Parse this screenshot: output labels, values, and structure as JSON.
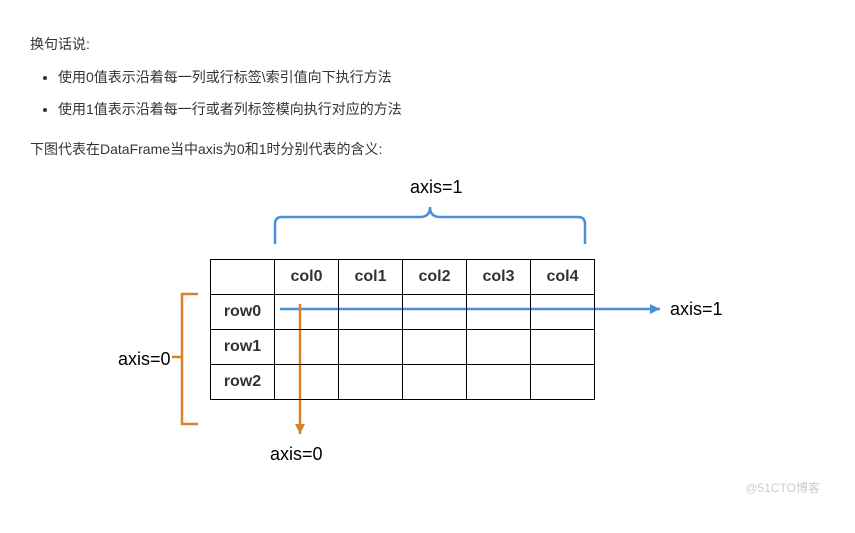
{
  "intro": "换句话说:",
  "bullets": [
    "使用0值表示沿着每一列或行标签\\索引值向下执行方法",
    "使用1值表示沿着每一行或者列标签模向执行对应的方法"
  ],
  "caption": "下图代表在DataFrame当中axis为0和1时分别代表的含义:",
  "diagram": {
    "axis1_top": "axis=1",
    "axis1_right": "axis=1",
    "axis0_left": "axis=0",
    "axis0_bottom": "axis=0",
    "columns": [
      "col0",
      "col1",
      "col2",
      "col3",
      "col4"
    ],
    "rows": [
      "row0",
      "row1",
      "row2"
    ]
  },
  "watermark": "@51CTO博客"
}
